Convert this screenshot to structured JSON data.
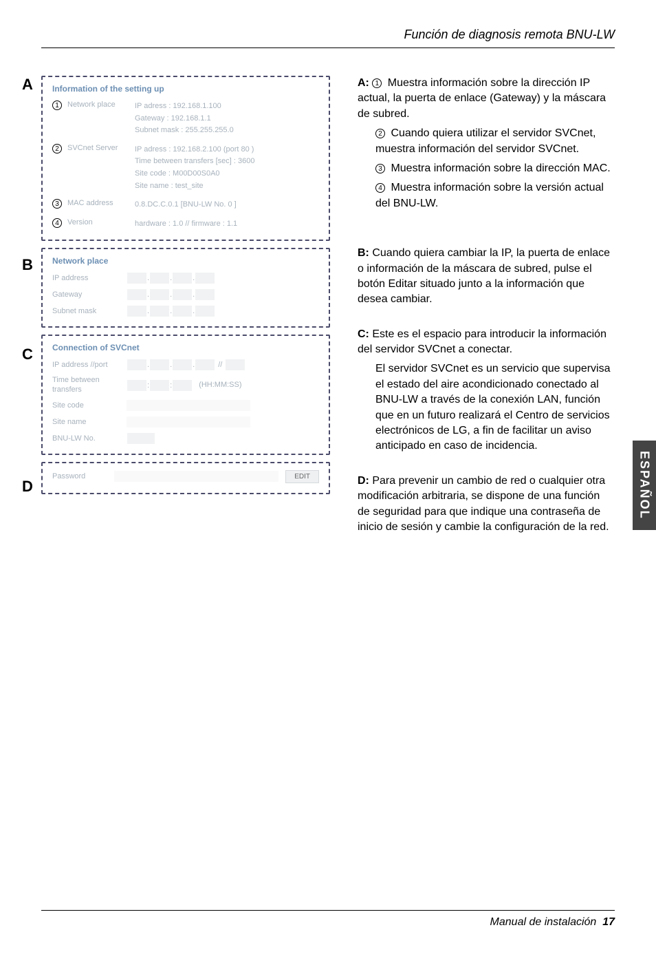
{
  "header": {
    "title": "Función de diagnosis remota BNU-LW"
  },
  "letters": {
    "A": "A",
    "B": "B",
    "C": "C",
    "D": "D"
  },
  "panelA": {
    "title": "Information of the setting up",
    "item1": {
      "num": "1",
      "label": "Network place",
      "l1": "IP adress : 192.168.1.100",
      "l2": "Gateway : 192.168.1.1",
      "l3": "Subnet mask : 255.255.255.0"
    },
    "item2": {
      "num": "2",
      "label": "SVCnet Server",
      "l1": "IP adress : 192.168.2.100 (port 80 )",
      "l2": "Time between transfers [sec] : 3600",
      "l3": "Site code : M00D00S0A0",
      "l4": "Site name : test_site"
    },
    "item3": {
      "num": "3",
      "label": "MAC address",
      "val": "0.8.DC.C.0.1    [BNU-LW No. 0 ]"
    },
    "item4": {
      "num": "4",
      "label": "Version",
      "val": "hardware : 1.0  //  firmware : 1.1"
    }
  },
  "panelB": {
    "title": "Network place",
    "row1": "IP address",
    "row2": "Gateway",
    "row3": "Subnet mask"
  },
  "panelC": {
    "title": "Connection of SVCnet",
    "row1": "IP address //port",
    "row2": "Time between transfers",
    "row2_suffix": "(HH:MM:SS)",
    "row3": "Site code",
    "row4": "Site name",
    "row5": "BNU-LW No."
  },
  "panelD": {
    "label": "Password",
    "btn": "EDIT"
  },
  "right": {
    "A": {
      "lead": "A:",
      "i1n": "1",
      "i1": "Muestra información sobre la dirección IP actual, la puerta de enlace (Gateway) y la máscara de subred.",
      "i2n": "2",
      "i2": "Cuando quiera utilizar el servidor SVCnet, muestra información del servidor SVCnet.",
      "i3n": "3",
      "i3": "Muestra información sobre la dirección MAC.",
      "i4n": "4",
      "i4": "Muestra información sobre la versión actual del BNU-LW."
    },
    "B": {
      "lead": "B:",
      "t": "Cuando quiera cambiar la IP, la puerta de enlace o información de la máscara de subred, pulse el botón Editar situado junto a la información que desea cambiar."
    },
    "C": {
      "lead": "C:",
      "t1": "Este es el espacio para introducir la información del servidor SVCnet a conectar.",
      "t2": "El servidor SVCnet es un servicio que supervisa el estado del aire acondicionado conectado al BNU-LW a través de la conexión LAN, función que en un futuro realizará el Centro de servicios electrónicos de LG, a fin de facilitar un aviso anticipado en caso de incidencia."
    },
    "D": {
      "lead": "D:",
      "t": "Para prevenir un cambio de red o cualquier otra modificación arbitraria, se dispone de una función de seguridad para que indique una contraseña de inicio de sesión y cambie la configuración de la red."
    }
  },
  "sidetab": "ESPAÑOL",
  "footer": {
    "text": "Manual de instalación",
    "page": "17"
  }
}
